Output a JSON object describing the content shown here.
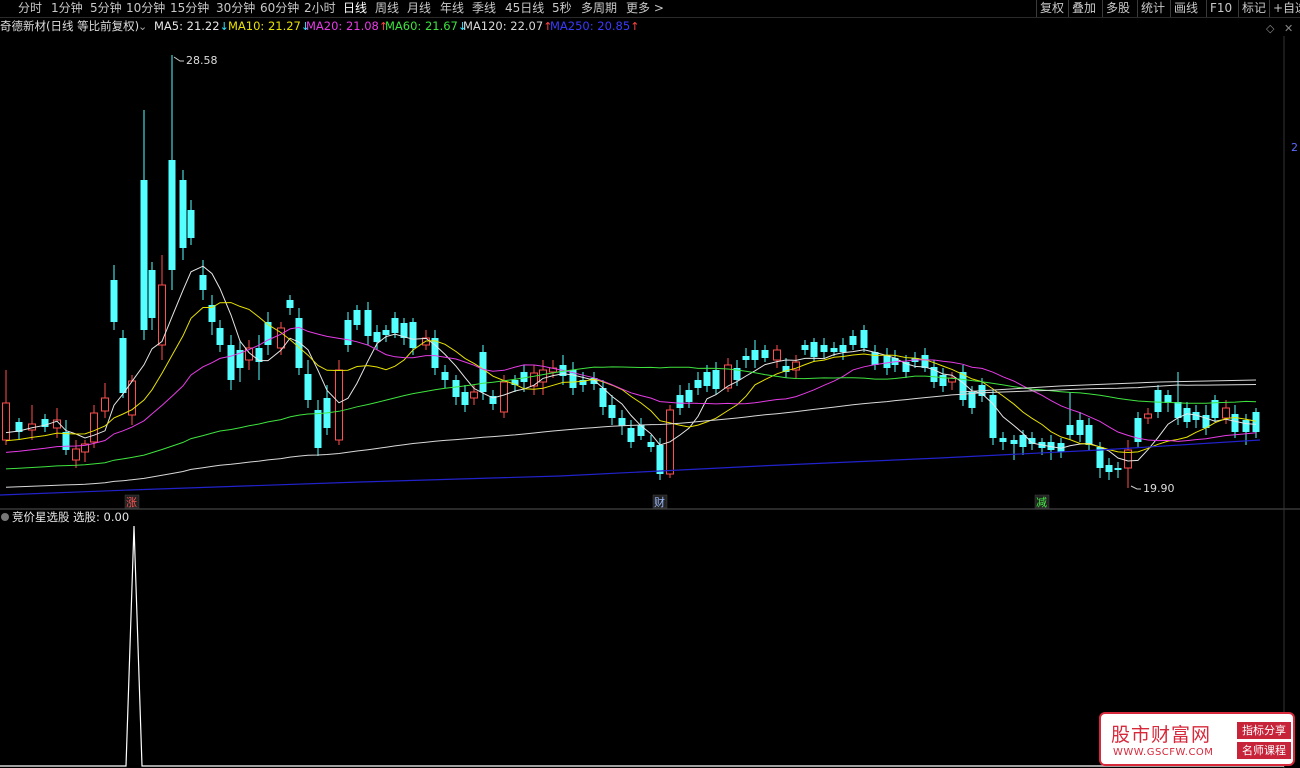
{
  "toolbar": {
    "periods": [
      "分时",
      "1分钟",
      "5分钟",
      "10分钟",
      "15分钟",
      "30分钟",
      "60分钟",
      "2小时",
      "日线",
      "周线",
      "月线",
      "年线",
      "季线",
      "45日线",
      "5秒",
      "多周期",
      "更多 >"
    ],
    "active_period": "日线",
    "right_buttons": [
      "复权",
      "叠加",
      "多股",
      "统计",
      "画线",
      "F10",
      "标记",
      "+自选"
    ]
  },
  "chart_header": {
    "stock_title": "奇德新材(日线 等比前复权)",
    "ma": [
      {
        "label": "MA5: 21.22",
        "arrow": "↓",
        "color": "#e6e6e6",
        "arrow_color": "#2fe6ff"
      },
      {
        "label": "MA10: 21.27",
        "arrow": "↓",
        "color": "#e8e200",
        "arrow_color": "#2fe6ff"
      },
      {
        "label": "MA20: 21.08",
        "arrow": "↑",
        "color": "#e63ce6",
        "arrow_color": "#ff4444"
      },
      {
        "label": "MA60: 21.67",
        "arrow": "↓",
        "color": "#3fe33f",
        "arrow_color": "#2fe6ff"
      },
      {
        "label": "MA120: 22.07",
        "arrow": "↑",
        "color": "#d8d8d8",
        "arrow_color": "#ff4444"
      },
      {
        "label": "MA250: 20.85",
        "arrow": "↑",
        "color": "#3a3aff",
        "arrow_color": "#ff4444"
      }
    ]
  },
  "price_labels": {
    "high": "28.58",
    "low": "19.90",
    "axis_partial": "2"
  },
  "event_markers": [
    {
      "text": "涨",
      "color": "#ff5555"
    },
    {
      "text": "财",
      "color": "#9ab8ff"
    },
    {
      "text": "减",
      "color": "#44ee44"
    }
  ],
  "indicator": {
    "name": "竞价星选股",
    "value_label": "选股: 0.00"
  },
  "watermark": {
    "title": "股市财富网",
    "url": "WWW.GSCFW.COM",
    "tag1": "指标分享",
    "tag2": "名师课程"
  },
  "colors": {
    "up": "#ff5050",
    "down": "#54ffff",
    "ma5": "#e6e6e6",
    "ma10": "#e8e200",
    "ma20": "#e63ce6",
    "ma60": "#3fe33f",
    "ma120": "#d8d8d8",
    "ma250": "#2222cc"
  }
}
